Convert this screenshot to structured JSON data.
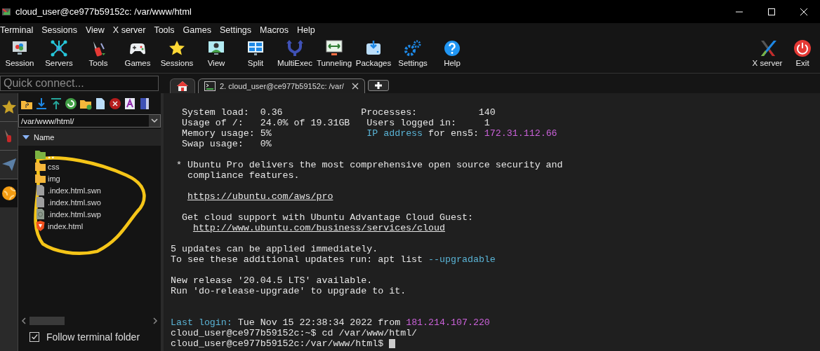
{
  "window": {
    "title": "cloud_user@ce977b59152c: /var/www/html"
  },
  "menu": [
    "Terminal",
    "Sessions",
    "View",
    "X server",
    "Tools",
    "Games",
    "Settings",
    "Macros",
    "Help"
  ],
  "toolbar": [
    "Session",
    "Servers",
    "Tools",
    "Games",
    "Sessions",
    "View",
    "Split",
    "MultiExec",
    "Tunneling",
    "Packages",
    "Settings",
    "Help"
  ],
  "toolbar_right": [
    "X server",
    "Exit"
  ],
  "quick_connect": {
    "placeholder": "Quick connect..."
  },
  "tabs": [
    {
      "kind": "home",
      "selected": false
    },
    {
      "kind": "terminal",
      "label": "2. cloud_user@ce977b59152c: /var/",
      "selected": true
    },
    {
      "kind": "add",
      "selected": false
    }
  ],
  "sidebar_tabs": [
    {
      "selected": false
    },
    {
      "selected": false
    },
    {
      "selected": false
    },
    {
      "selected": true
    }
  ],
  "file_browser": {
    "path": "/var/www/html/",
    "column": "Name",
    "items": [
      {
        "name": "..",
        "kind": "parent"
      },
      {
        "name": "css",
        "kind": "folder"
      },
      {
        "name": "img",
        "kind": "folder"
      },
      {
        "name": ".index.html.swn",
        "kind": "file"
      },
      {
        "name": ".index.html.swo",
        "kind": "file"
      },
      {
        "name": ".index.html.swp",
        "kind": "swap"
      },
      {
        "name": "index.html",
        "kind": "html"
      }
    ],
    "follow_folder": {
      "label": "Follow terminal folder",
      "checked": true
    }
  },
  "annotation": {
    "kind": "circle"
  },
  "terminal": {
    "blocks": [
      {
        "lines": [
          {
            "kind": "plain",
            "segments": [
              {
                "kind": "plain",
                "text": "  System load:  0.36              Processes:           140"
              }
            ]
          },
          {
            "kind": "plain",
            "segments": [
              {
                "kind": "plain",
                "text": "  Usage of /:   24.0% of 19.31GB   Users logged in:     1"
              }
            ]
          },
          {
            "kind": "plain",
            "segments": [
              {
                "kind": "plain",
                "text": "  Memory usage: 5%                 "
              },
              {
                "kind": "cyan",
                "text": "IP address"
              },
              {
                "kind": "plain",
                "text": " for ens5: "
              },
              {
                "kind": "magenta",
                "text": "172.31.112.66"
              }
            ]
          },
          {
            "kind": "plain",
            "segments": [
              {
                "kind": "plain",
                "text": "  Swap usage:   0%"
              }
            ]
          }
        ]
      },
      {
        "lines": [
          {
            "kind": "plain",
            "segments": [
              {
                "kind": "plain",
                "text": " * Ubuntu Pro delivers the most comprehensive open source security and"
              }
            ]
          },
          {
            "kind": "plain",
            "segments": [
              {
                "kind": "plain",
                "text": "   compliance features."
              }
            ]
          }
        ]
      },
      {
        "lines": [
          {
            "kind": "indented",
            "segments": [
              {
                "kind": "link",
                "text": "https://ubuntu.com/aws/pro"
              }
            ]
          }
        ]
      },
      {
        "lines": [
          {
            "kind": "plain",
            "segments": [
              {
                "kind": "plain",
                "text": "  Get cloud support with Ubuntu Advantage Cloud Guest:"
              }
            ]
          },
          {
            "kind": "nested",
            "segments": [
              {
                "kind": "link",
                "text": "http://www.ubuntu.com/business/services/cloud"
              }
            ]
          }
        ]
      },
      {
        "lines": [
          {
            "kind": "plain",
            "segments": [
              {
                "kind": "plain",
                "text": "5 updates can be applied immediately."
              }
            ]
          },
          {
            "kind": "plain",
            "segments": [
              {
                "kind": "plain",
                "text": "To see these additional updates run: apt list "
              },
              {
                "kind": "cyan",
                "text": "--upgradable"
              }
            ]
          }
        ]
      },
      {
        "lines": [
          {
            "kind": "plain",
            "segments": [
              {
                "kind": "plain",
                "text": "New release '20.04.5 LTS' available."
              }
            ]
          },
          {
            "kind": "plain",
            "segments": [
              {
                "kind": "plain",
                "text": "Run 'do-release-upgrade' to upgrade to it."
              }
            ]
          }
        ]
      },
      {
        "lines": [
          {
            "kind": "plain",
            "segments": [
              {
                "kind": "cyan",
                "text": "Last login:"
              },
              {
                "kind": "plain",
                "text": " Tue Nov 15 22:38:34 2022 from "
              },
              {
                "kind": "magenta",
                "text": "181.214.107.220"
              }
            ]
          },
          {
            "kind": "plain",
            "segments": [
              {
                "kind": "plain",
                "text": "cloud_user@ce977b59152c:~$ cd /var/www/html/"
              }
            ]
          },
          {
            "kind": "plain",
            "cursor": true,
            "segments": [
              {
                "kind": "plain",
                "text": "cloud_user@ce977b59152c:/var/www/html$ "
              }
            ]
          }
        ]
      }
    ]
  }
}
